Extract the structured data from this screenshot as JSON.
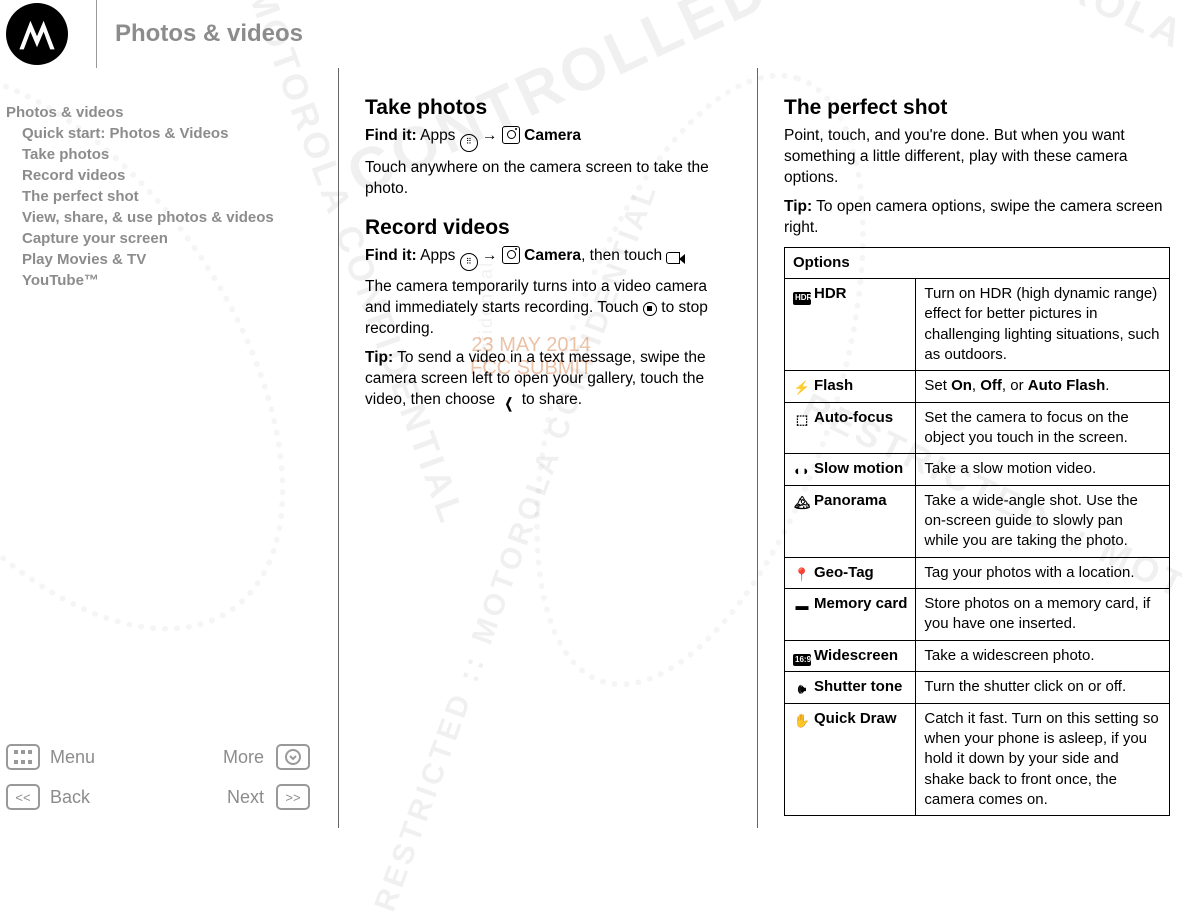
{
  "header": {
    "title": "Photos & videos"
  },
  "toc": {
    "top": "Photos & videos",
    "items": [
      "Quick start: Photos & Videos",
      "Take photos",
      "Record videos",
      "The perfect shot",
      "View, share, & use photos & videos",
      "Capture your screen",
      "Play Movies & TV",
      "YouTube™"
    ]
  },
  "nav": {
    "menu": "Menu",
    "more": "More",
    "back": "Back",
    "next": "Next"
  },
  "col1": {
    "h_take": "Take photos",
    "take_find_prefix": "Find it:",
    "take_find_apps": " Apps ",
    "take_find_arrow": " → ",
    "take_find_camera": " Camera",
    "take_body": "Touch anywhere on the camera screen to take the photo.",
    "h_record": "Record videos",
    "record_find_prefix": "Find it:",
    "record_find_apps": " Apps ",
    "record_find_arrow": " → ",
    "record_find_camera": " Camera",
    "record_find_then": ", then touch ",
    "record_body1_a": "The camera temporarily turns into a video camera and immediately starts recording. Touch ",
    "record_body1_b": " to stop recording.",
    "record_tip_prefix": "Tip:",
    "record_tip_a": " To send a video in a text message, swipe the camera screen left to open your gallery, touch the video, then choose ",
    "record_tip_b": " to share."
  },
  "col2": {
    "h_perfect": "The perfect shot",
    "perfect_body": "Point, touch, and you're done. But when you want something a little different, play with these camera options.",
    "perfect_tip_prefix": "Tip:",
    "perfect_tip": " To open camera options, swipe the camera screen right.",
    "options_header": "Options",
    "options": [
      {
        "icon": "HDR",
        "name": "HDR",
        "desc": "Turn on HDR (high dynamic range) effect for better pictures in challenging lighting situations, such as outdoors."
      },
      {
        "icon": "⚡",
        "name": "Flash",
        "desc_html": "Set <b>On</b>, <b>Off</b>, or <b>Auto Flash</b>."
      },
      {
        "icon": "⬚",
        "name": "Auto-focus",
        "desc": "Set the camera to focus on the object you touch in the screen."
      },
      {
        "icon": "◐◗",
        "name": "Slow motion",
        "desc": "Take a slow motion video."
      },
      {
        "icon": "🏔",
        "name": "Panorama",
        "desc": "Take a wide-angle shot. Use the on-screen guide to slowly pan while you are taking the photo."
      },
      {
        "icon": "📍",
        "name": "Geo-Tag",
        "desc": "Tag your photos with a location."
      },
      {
        "icon": "▬",
        "name": "Memory card",
        "desc": "Store photos on a memory card, if you have one inserted."
      },
      {
        "icon": "16:9",
        "name": "Widescreen",
        "desc": "Take a widescreen photo."
      },
      {
        "icon": "🕪",
        "name": "Shutter tone",
        "desc": "Turn the shutter click on or off."
      },
      {
        "icon": "✋",
        "name": "Quick Draw",
        "desc": "Catch it fast. Turn on this setting so when your phone is asleep, if you hold it down by your side and shake back to front once, the camera comes on."
      }
    ]
  },
  "watermark": {
    "copy": "CONTROLLED COPY",
    "restricted": "RESTRICTED :: MOTOROLA CONFIDENTIAL",
    "date": "23 MAY 2014",
    "submit": "FCC SUBMIT",
    "conf": "Confidential"
  }
}
